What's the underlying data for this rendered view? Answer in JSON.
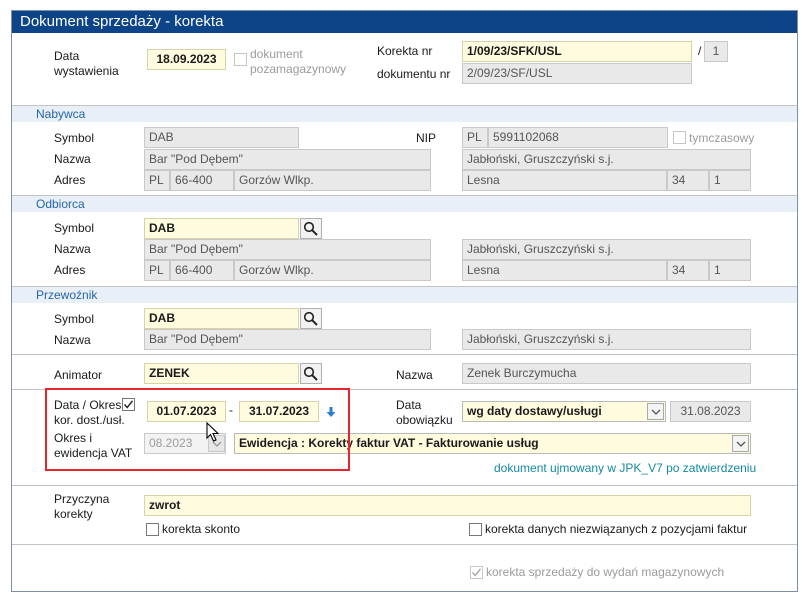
{
  "window": {
    "title": "Dokument sprzedaży - korekta"
  },
  "header": {
    "data_wystawienia_label": "Data wystawienia",
    "data_wystawienia": "18.09.2023",
    "pozamagazynowy_label": "dokument pozamagazynowy",
    "korekta_nr_label": "Korekta nr",
    "korekta_nr": "1/09/23/SFK/USL",
    "slash": "/",
    "korekta_seq": "1",
    "dokumentu_nr_label": "dokumentu nr",
    "dokumentu_nr": "2/09/23/SF/USL"
  },
  "nabywca": {
    "section": "Nabywca",
    "symbol_label": "Symbol",
    "symbol": "DAB",
    "nazwa_label": "Nazwa",
    "nazwa": "Bar \"Pod Dębem\"",
    "adres_label": "Adres",
    "country": "PL",
    "zip": "66-400",
    "city": "Gorzów Wlkp.",
    "nip_label": "NIP",
    "nip_country": "PL",
    "nip": "5991102068",
    "tymczasowy_label": "tymczasowy",
    "nazwa2": "Jabłoński, Gruszczyński s.j.",
    "street": "Lesna",
    "house": "34",
    "flat": "1"
  },
  "odbiorca": {
    "section": "Odbiorca",
    "symbol_label": "Symbol",
    "symbol": "DAB",
    "nazwa_label": "Nazwa",
    "nazwa": "Bar \"Pod Dębem\"",
    "adres_label": "Adres",
    "country": "PL",
    "zip": "66-400",
    "city": "Gorzów Wlkp.",
    "nazwa2": "Jabłoński, Gruszczyński s.j.",
    "street": "Lesna",
    "house": "34",
    "flat": "1"
  },
  "przewoznik": {
    "section": "Przewoźnik",
    "symbol_label": "Symbol",
    "symbol": "DAB",
    "nazwa_label": "Nazwa",
    "nazwa": "Bar \"Pod Dębem\"",
    "nazwa2": "Jabłoński, Gruszczyński s.j."
  },
  "animator": {
    "label": "Animator",
    "value": "ZENEK",
    "nazwa_label": "Nazwa",
    "nazwa": "Zenek Burczymucha"
  },
  "okres": {
    "data_okres_label": "Data / Okres",
    "kor_label": "kor. dost./usł.",
    "date_from": "01.07.2023",
    "dash": "-",
    "date_to": "31.07.2023",
    "okres_vat_label": "Okres i ewidencja VAT",
    "okres_vat": "08.2023",
    "ewidencja": "Ewidencja : Korekty faktur VAT - Fakturowanie usług",
    "data_obow_label": "Data obowiązku",
    "obow_mode": "wg daty dostawy/usługi",
    "obow_date": "31.08.2023",
    "jpk_link": "dokument ujmowany w JPK_V7 po zatwierdzeniu"
  },
  "przyczyna": {
    "label": "Przyczyna korekty",
    "value": "zwrot",
    "skonto_label": "korekta skonto",
    "danych_label": "korekta danych niezwiązanych z pozycjami faktur"
  },
  "footer": {
    "magazyn_label": "korekta sprzedaży do wydań magazynowych"
  },
  "colors": {
    "title_bar": "#0d4487",
    "section_text": "#2466a6",
    "highlight_box": "#e8252c",
    "required_field": "#fffbdf"
  }
}
